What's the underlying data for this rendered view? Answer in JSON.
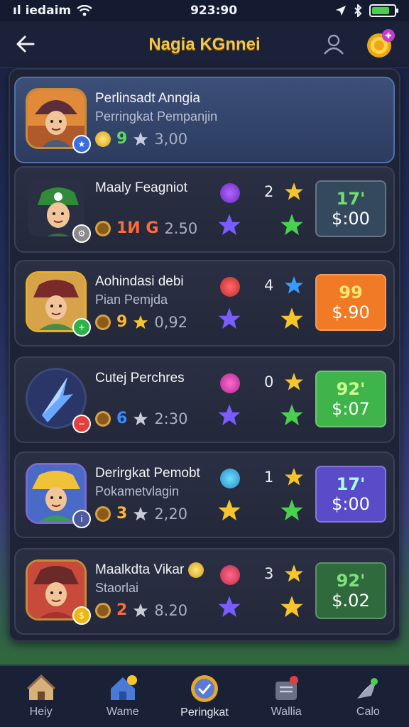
{
  "status": {
    "carrier": "ıl iedaim",
    "time": "923:90"
  },
  "header": {
    "title": "Nagia KGnnei"
  },
  "rows": [
    {
      "name": "Perlinsadt Anngia",
      "tag": "",
      "subtitle": "Perringkat Pempanjin",
      "level": "9",
      "value": "3,00",
      "colors": {
        "level": "#5bdc5a",
        "frame": "#c58b3b",
        "badge": "#3a6ee0"
      }
    },
    {
      "name": "Maaly Feagniot",
      "subtitle": "",
      "level": "1И G",
      "value": "2.50",
      "count": "2",
      "price_top": "17'",
      "price_bottom": "$:00",
      "colors": {
        "level": "#ff6a3a",
        "price_bg": "#34485e",
        "price_top": "#6fe070",
        "badge": "#8a8a8a"
      }
    },
    {
      "name": "Aohindasi debi",
      "subtitle": "Pian Pemjda",
      "level": "9",
      "value": "0,92",
      "count": "4",
      "price_top": "99",
      "price_bottom": "$.90",
      "colors": {
        "level": "#ffb533",
        "price_bg": "#f07a26",
        "price_top": "#ffe66e",
        "badge": "#2fb04a"
      }
    },
    {
      "name": "Cutej Perchres",
      "subtitle": "",
      "level": "6",
      "value": "2:30",
      "count": "0",
      "price_top": "92'",
      "price_bottom": "$:07",
      "colors": {
        "level": "#3a8cff",
        "price_bg": "#3eb44a",
        "price_top": "#c9ff8e",
        "badge": "#e04040"
      }
    },
    {
      "name": "Derirgkat Pemobt",
      "subtitle": "Pokametvlagin",
      "level": "3",
      "value": "2,20",
      "count": "1",
      "price_top": "17'",
      "price_bottom": "$:00",
      "colors": {
        "level": "#ffb533",
        "price_bg": "#5a4cc8",
        "price_top": "#a6ffe6",
        "badge": "#4e5aa0"
      }
    },
    {
      "name": "Maalkdta Vikar",
      "subtitle": "Staorlai",
      "level": "2",
      "value": "8.20",
      "count": "3",
      "price_top": "92'",
      "price_bottom": "$.02",
      "colors": {
        "level": "#ff6a3a",
        "price_bg": "#2e6a3c",
        "price_top": "#7ee07e",
        "badge": "#e8b817"
      }
    }
  ],
  "nav": [
    {
      "label": "Heiy",
      "icon": "home-icon"
    },
    {
      "label": "Wame",
      "icon": "house-badge-icon"
    },
    {
      "label": "Peringkat",
      "icon": "ranking-medal-icon"
    },
    {
      "label": "Wallia",
      "icon": "wallet-icon"
    },
    {
      "label": "Calo",
      "icon": "compass-icon"
    }
  ]
}
